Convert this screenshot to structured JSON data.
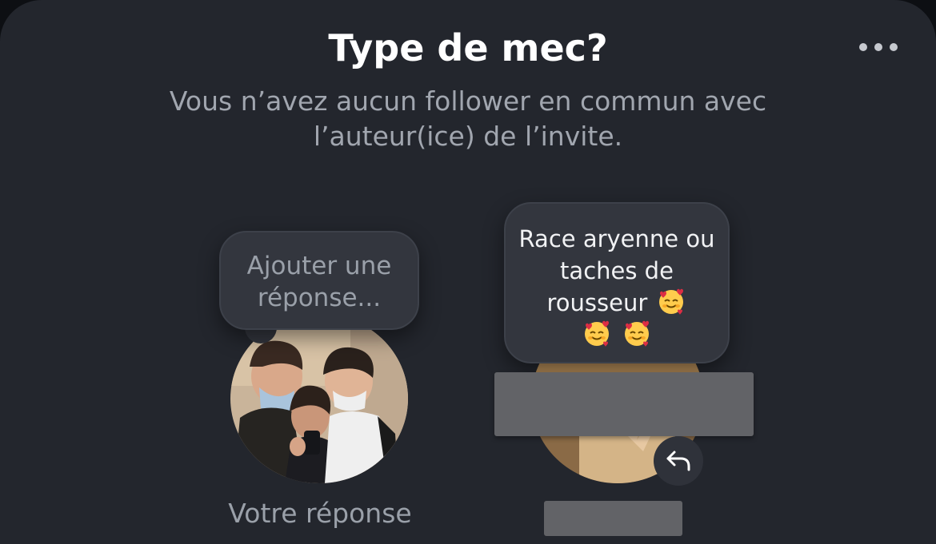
{
  "header": {
    "title": "Type de mec?",
    "more_icon": "more-horizontal-icon"
  },
  "notice": {
    "text": "Vous n’avez aucun follower en commun avec l’auteur(ice) de l’invite."
  },
  "my_reply": {
    "placeholder": "Ajouter une réponse...",
    "caption": "Votre réponse"
  },
  "other_reply": {
    "text": "Race aryenne ou taches de rousseur",
    "emoji": "smiling-face-with-hearts",
    "emoji_count": 3,
    "reply_icon": "reply-arrow-icon"
  },
  "colors": {
    "background": "#23262d",
    "bubble": "#33363e",
    "redaction": "#626367"
  }
}
